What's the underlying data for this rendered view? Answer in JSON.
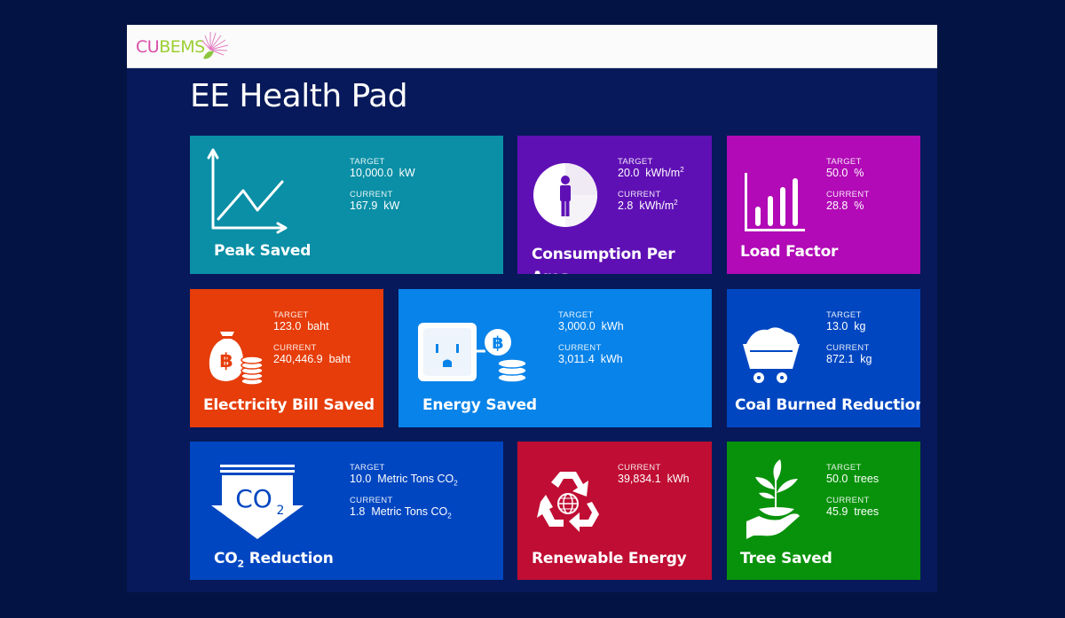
{
  "app": {
    "logo_part1": "CU",
    "logo_part2": "BEMS"
  },
  "page": {
    "title": "EE Health Pad"
  },
  "labels": {
    "target": "TARGET",
    "current": "CURRENT"
  },
  "tiles": {
    "peak_saved": {
      "title": "Peak Saved",
      "target": "10,000.0",
      "current": "167.9",
      "unit": "kW",
      "color": "#0a8fa6",
      "icon": "line-chart-icon"
    },
    "consumption_per_area": {
      "title": "Consumption Per Area",
      "target": "20.0",
      "current": "2.8",
      "unit_base": "kWh/m",
      "unit_exp": "2",
      "color": "#5f10b5",
      "icon": "person-area-icon"
    },
    "load_factor": {
      "title": "Load Factor",
      "target": "50.0",
      "current": "28.8",
      "unit": "%",
      "color": "#b10ab6",
      "icon": "bar-chart-icon"
    },
    "electricity_bill_saved": {
      "title": "Electricity Bill Saved",
      "target": "123.0",
      "current": "240,446.9",
      "unit": "baht",
      "color": "#e63d0a",
      "icon": "money-bag-icon"
    },
    "energy_saved": {
      "title": "Energy Saved",
      "target": "3,000.0",
      "current": "3,011.4",
      "unit": "kWh",
      "color": "#0883e9",
      "icon": "power-outlet-icon"
    },
    "coal_burned_reduction": {
      "title": "Coal Burned Reduction",
      "target": "13.0",
      "current": "872.1",
      "unit": "kg",
      "color": "#0046c1",
      "icon": "coal-cart-icon"
    },
    "co2_reduction": {
      "title_prefix": "CO",
      "title_sub": "2",
      "title_suffix": " Reduction",
      "target": "10.0",
      "current": "1.8",
      "unit_base": "Metric Tons CO",
      "unit_sub": "2",
      "icon_text": "CO",
      "icon_sub": "2",
      "color": "#0046c1",
      "icon": "co2-arrow-icon"
    },
    "renewable_energy": {
      "title": "Renewable Energy",
      "current": "39,834.1",
      "unit": "kWh",
      "color": "#c00d33",
      "icon": "recycle-globe-icon"
    },
    "tree_saved": {
      "title": "Tree Saved",
      "target": "50.0",
      "current": "45.9",
      "unit": "trees",
      "color": "#08920b",
      "icon": "hand-plant-icon"
    }
  }
}
